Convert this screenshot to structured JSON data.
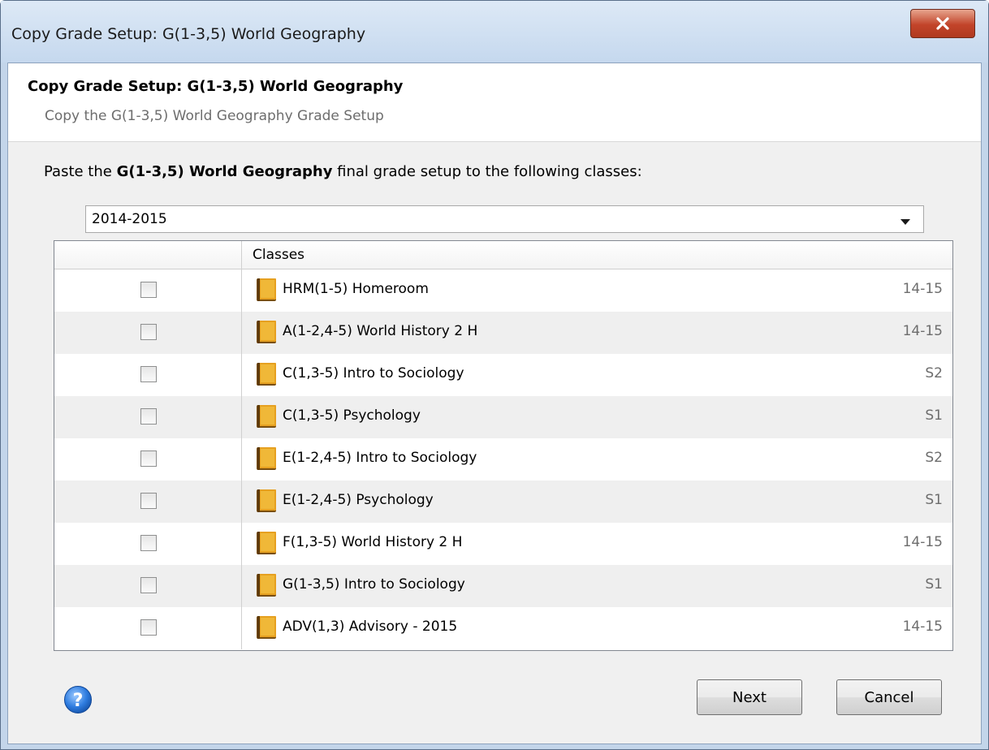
{
  "window": {
    "title": "Copy Grade Setup: G(1-3,5) World Geography"
  },
  "header": {
    "title": "Copy Grade Setup: G(1-3,5) World Geography",
    "subtitle": "Copy the G(1-3,5) World Geography Grade Setup"
  },
  "instruction": {
    "prefix": "Paste the ",
    "class_name": "G(1-3,5) World Geography",
    "suffix": " final grade setup to the following classes:"
  },
  "year_select": {
    "value": "2014-2015"
  },
  "table": {
    "column_classes": "Classes",
    "rows": [
      {
        "name": "HRM(1-5) Homeroom",
        "term": "14-15",
        "checked": false
      },
      {
        "name": "A(1-2,4-5) World History 2 H",
        "term": "14-15",
        "checked": false
      },
      {
        "name": "C(1,3-5) Intro to Sociology",
        "term": "S2",
        "checked": false
      },
      {
        "name": "C(1,3-5) Psychology",
        "term": "S1",
        "checked": false
      },
      {
        "name": "E(1-2,4-5) Intro to Sociology",
        "term": "S2",
        "checked": false
      },
      {
        "name": "E(1-2,4-5) Psychology",
        "term": "S1",
        "checked": false
      },
      {
        "name": "F(1,3-5) World History 2 H",
        "term": "14-15",
        "checked": false
      },
      {
        "name": "G(1-3,5) Intro to Sociology",
        "term": "S1",
        "checked": false
      },
      {
        "name": "ADV(1,3) Advisory - 2015",
        "term": "14-15",
        "checked": false
      }
    ]
  },
  "buttons": {
    "next": "Next",
    "cancel": "Cancel"
  },
  "icons": {
    "close": "close-icon",
    "help": "help-icon",
    "class": "book-icon",
    "dropdown": "chevron-down-icon"
  }
}
